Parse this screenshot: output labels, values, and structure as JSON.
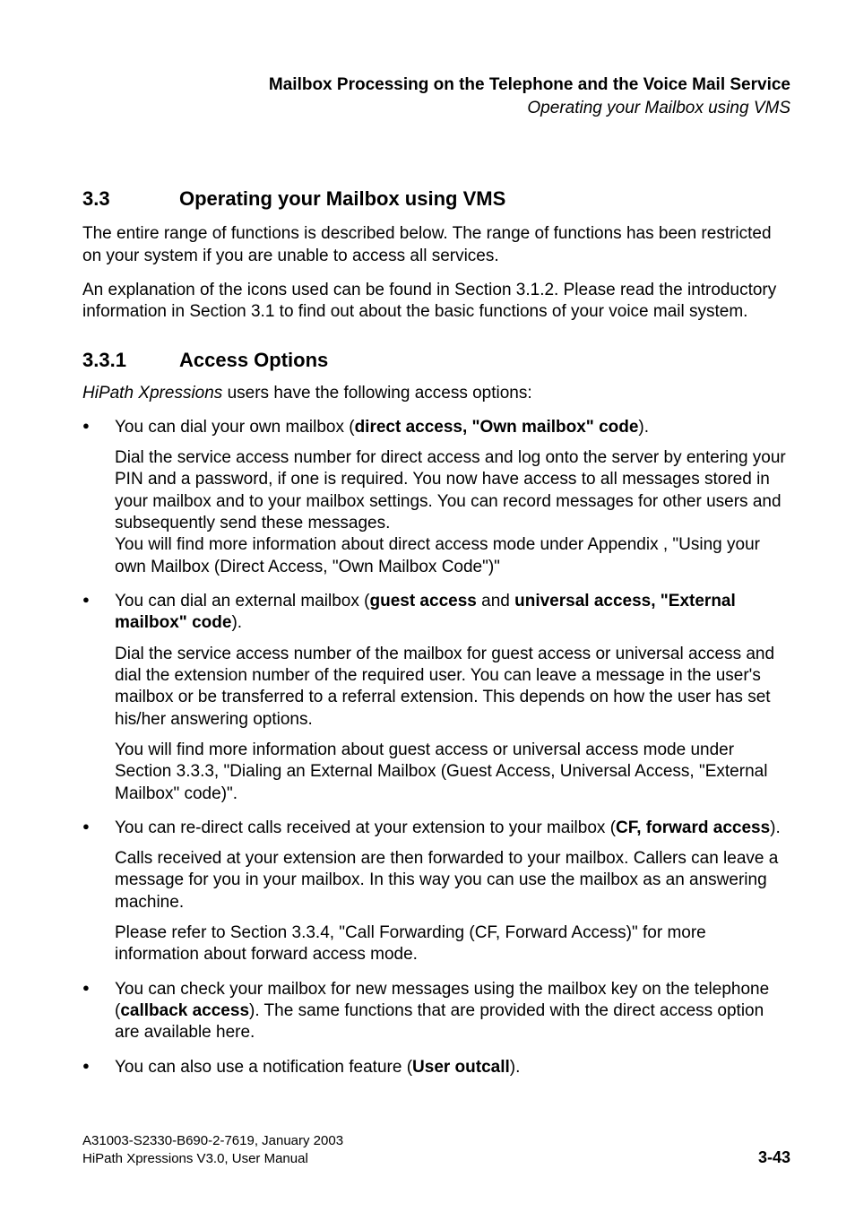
{
  "header": {
    "title": "Mailbox Processing on the Telephone and the Voice Mail Service",
    "subtitle": "Operating your Mailbox using VMS"
  },
  "section": {
    "num": "3.3",
    "title": "Operating your Mailbox using VMS",
    "p1": "The entire range of functions is described below. The range of functions has been restricted on your system if you are unable to access all services.",
    "p2": "An explanation of the icons used can be found in Section 3.1.2. Please read the introductory information in Section 3.1 to find out about the basic functions of your voice mail system."
  },
  "subsection": {
    "num": "3.3.1",
    "title": "Access Options",
    "intro_prefix": "HiPath Xpressions",
    "intro_rest": " users have the following access options:"
  },
  "items": {
    "i1": {
      "lead_a": "You can dial your own mailbox (",
      "lead_bold": "direct access, \"Own mailbox\" code",
      "lead_c": ").",
      "p1": "Dial the service access number for direct access and log onto the server by entering your PIN and a password, if one is required. You now have access to all messages stored in your mailbox and to your mailbox settings. You can record messages for other users and subsequently send these messages.",
      "p2": "You will find more information about direct access mode under Appendix , \"Using your own Mailbox (Direct Access, \"Own Mailbox Code\")\""
    },
    "i2": {
      "lead_a": "You can dial an external mailbox (",
      "lead_bold1": "guest access",
      "lead_mid": " and ",
      "lead_bold2": "universal access, \"External mailbox\" code",
      "lead_c": ").",
      "p1": "Dial the service access number of the mailbox for guest access or universal access and dial the extension number of the required user. You can leave a message in the user's mailbox or be transferred to a referral extension. This depends on how the user has set his/her answering options.",
      "p2": "You will find more information about guest access or universal access mode under Section 3.3.3, \"Dialing an External Mailbox (Guest Access, Universal Access, \"External Mailbox\" code)\"."
    },
    "i3": {
      "lead_a": "You can re-direct calls received at your extension to your mailbox (",
      "lead_bold": "CF, forward access",
      "lead_c": ").",
      "p1": "Calls received at your extension are then forwarded to your mailbox. Callers can leave a message for you in your mailbox. In this way you can use the mailbox as an answering machine.",
      "p2": "Please refer to Section 3.3.4, \"Call Forwarding (CF, Forward Access)\" for more information about forward access mode."
    },
    "i4": {
      "lead_a": "You can check your mailbox for new messages using the mailbox key on the telephone (",
      "lead_bold": "callback access",
      "lead_c": "). The same functions that are provided with the direct access option are available here."
    },
    "i5": {
      "lead_a": "You can also use a notification feature (",
      "lead_bold": "User outcall",
      "lead_c": ")."
    }
  },
  "footer": {
    "line1": "A31003-S2330-B690-2-7619, January 2003",
    "line2": "HiPath Xpressions V3.0, User Manual",
    "pagenum": "3-43"
  }
}
